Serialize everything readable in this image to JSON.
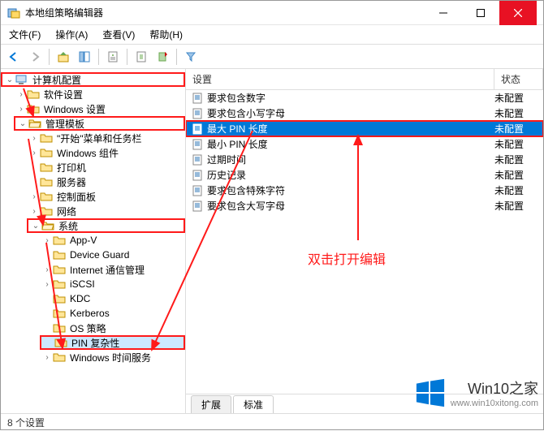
{
  "window": {
    "title": "本地组策略编辑器"
  },
  "menu": {
    "file": "文件(F)",
    "action": "操作(A)",
    "view": "查看(V)",
    "help": "帮助(H)"
  },
  "tree": {
    "root": "计算机配置",
    "software": "软件设置",
    "windows_settings": "Windows 设置",
    "admin_templates": "管理模板",
    "start_menu": "\"开始\"菜单和任务栏",
    "win_components": "Windows 组件",
    "printers": "打印机",
    "servers": "服务器",
    "control_panel": "控制面板",
    "network": "网络",
    "system": "系统",
    "appv": "App-V",
    "device_guard": "Device Guard",
    "internet_comm": "Internet 通信管理",
    "iscsi": "iSCSI",
    "kdc": "KDC",
    "kerberos": "Kerberos",
    "os_policy": "OS 策略",
    "pin_complexity": "PIN 复杂性",
    "win_time": "Windows 时间服务"
  },
  "columns": {
    "setting": "设置",
    "state": "状态"
  },
  "rows": [
    {
      "label": "要求包含数字",
      "state": "未配置"
    },
    {
      "label": "要求包含小写字母",
      "state": "未配置"
    },
    {
      "label": "最大 PIN 长度",
      "state": "未配置",
      "selected": true
    },
    {
      "label": "最小 PIN 长度",
      "state": "未配置"
    },
    {
      "label": "过期时间",
      "state": "未配置"
    },
    {
      "label": "历史记录",
      "state": "未配置"
    },
    {
      "label": "要求包含特殊字符",
      "state": "未配置"
    },
    {
      "label": "要求包含大写字母",
      "state": "未配置"
    }
  ],
  "tabs": {
    "extended": "扩展",
    "standard": "标准"
  },
  "status": "8 个设置",
  "annotation": {
    "hint": "双击打开编辑"
  },
  "watermark": {
    "title": "Win10之家",
    "url": "www.win10xitong.com"
  }
}
